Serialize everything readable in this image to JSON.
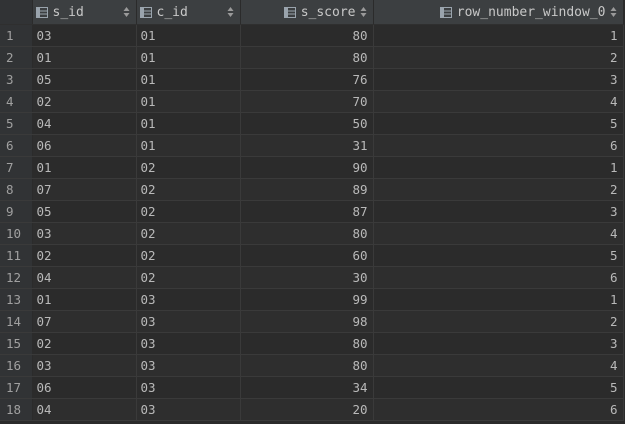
{
  "columns": [
    {
      "label": "s_id",
      "icon": "column-icon",
      "sort_icon": "sort-arrows-icon"
    },
    {
      "label": "c_id",
      "icon": "column-icon",
      "sort_icon": "sort-arrows-icon"
    },
    {
      "label": "s_score",
      "icon": "column-icon",
      "sort_icon": "sort-arrows-icon"
    },
    {
      "label": "row_number_window_0",
      "icon": "column-icon",
      "sort_icon": "sort-arrows-icon"
    }
  ],
  "rows": [
    {
      "n": "1",
      "s_id": "03",
      "c_id": "01",
      "s_score": "80",
      "rank": "1"
    },
    {
      "n": "2",
      "s_id": "01",
      "c_id": "01",
      "s_score": "80",
      "rank": "2"
    },
    {
      "n": "3",
      "s_id": "05",
      "c_id": "01",
      "s_score": "76",
      "rank": "3"
    },
    {
      "n": "4",
      "s_id": "02",
      "c_id": "01",
      "s_score": "70",
      "rank": "4"
    },
    {
      "n": "5",
      "s_id": "04",
      "c_id": "01",
      "s_score": "50",
      "rank": "5"
    },
    {
      "n": "6",
      "s_id": "06",
      "c_id": "01",
      "s_score": "31",
      "rank": "6"
    },
    {
      "n": "7",
      "s_id": "01",
      "c_id": "02",
      "s_score": "90",
      "rank": "1"
    },
    {
      "n": "8",
      "s_id": "07",
      "c_id": "02",
      "s_score": "89",
      "rank": "2"
    },
    {
      "n": "9",
      "s_id": "05",
      "c_id": "02",
      "s_score": "87",
      "rank": "3"
    },
    {
      "n": "10",
      "s_id": "03",
      "c_id": "02",
      "s_score": "80",
      "rank": "4"
    },
    {
      "n": "11",
      "s_id": "02",
      "c_id": "02",
      "s_score": "60",
      "rank": "5"
    },
    {
      "n": "12",
      "s_id": "04",
      "c_id": "02",
      "s_score": "30",
      "rank": "6"
    },
    {
      "n": "13",
      "s_id": "01",
      "c_id": "03",
      "s_score": "99",
      "rank": "1"
    },
    {
      "n": "14",
      "s_id": "07",
      "c_id": "03",
      "s_score": "98",
      "rank": "2"
    },
    {
      "n": "15",
      "s_id": "02",
      "c_id": "03",
      "s_score": "80",
      "rank": "3"
    },
    {
      "n": "16",
      "s_id": "03",
      "c_id": "03",
      "s_score": "80",
      "rank": "4"
    },
    {
      "n": "17",
      "s_id": "06",
      "c_id": "03",
      "s_score": "34",
      "rank": "5"
    },
    {
      "n": "18",
      "s_id": "04",
      "c_id": "03",
      "s_score": "20",
      "rank": "6"
    }
  ],
  "colors": {
    "background": "#2b2b2b",
    "header": "#3c3f41",
    "gutter": "#313335",
    "grid_line": "#3a3a3a",
    "text": "#b9b9b9"
  }
}
